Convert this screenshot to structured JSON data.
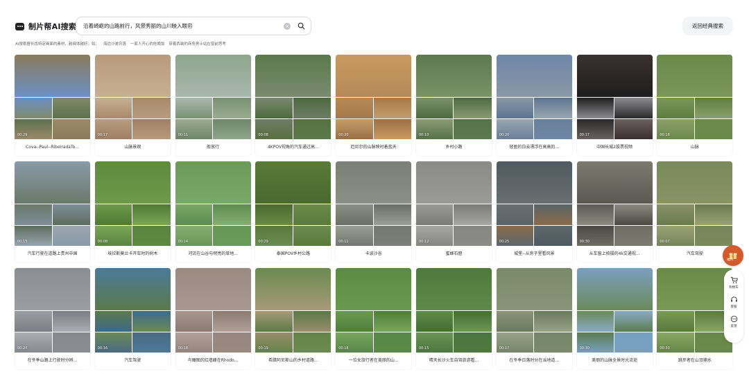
{
  "header": {
    "logo_text": "制片帮AI搜索",
    "search_value": "沿着崎岖的山路前行，风景秀丽的山川映入眼帘",
    "clear_label": "×",
    "return_label": "返回经典搜索",
    "hint_segments": [
      "AI搜索擅长找特定画面的素材，越具体越好。如：",
      "海边沙滩日落",
      "一家人开心的吃晚饭",
      "穿着西装的商务男士站在窗前思考"
    ]
  },
  "cards": [
    {
      "caption": "Cova--Paul--RibeiradaTo...",
      "duration": "00:29",
      "colors": [
        "#8a7b5c",
        "#6b8fc4",
        "#7f8b6a",
        "#5c7050",
        "#9a8a68"
      ]
    },
    {
      "caption": "山脉景观",
      "duration": "00:17",
      "colors": [
        "#b89a7a",
        "#c6b092",
        "#a88a6a",
        "#b79c7e",
        "#9f8064"
      ]
    },
    {
      "caption": "般放行",
      "duration": "00:11",
      "colors": [
        "#8ea58c",
        "#a9b8ae",
        "#7a9172",
        "#9aab90",
        "#6f8668"
      ]
    },
    {
      "caption": "4KPOV视角的汽车通过高...",
      "duration": "00:08",
      "colors": [
        "#5a7a4a",
        "#7a8a70",
        "#4c6a3e",
        "#6e7c66",
        "#58703f"
      ]
    },
    {
      "caption": "厄尼尔的山脉映衬着蓝天",
      "duration": "00:20",
      "colors": [
        "#c89a60",
        "#b58a58",
        "#a67848",
        "#c69c6a",
        "#9c7046"
      ]
    },
    {
      "caption": "乡村小路",
      "duration": "00:10",
      "colors": [
        "#5c7a4e",
        "#7a9266",
        "#4e6a42",
        "#8a9a74",
        "#56724a"
      ]
    },
    {
      "caption": "轻盈的白云漂浮在高高的...",
      "duration": "00:20",
      "colors": [
        "#6e86a8",
        "#8a98a6",
        "#5c7490",
        "#9aa6b0",
        "#6a8098"
      ]
    },
    {
      "caption": "中国长城2股票视频",
      "duration": "00:17",
      "colors": [
        "#3a3030",
        "#1e1e1e",
        "#8c8c90",
        "#2a2a2a",
        "#6a6060"
      ]
    },
    {
      "caption": "山脉",
      "duration": "00:18",
      "colors": [
        "#6a8a4a",
        "#7a9658",
        "#5e7e40",
        "#8aa068",
        "#6c8a4c"
      ]
    },
    {
      "caption": "汽车行驶在道路上贵州中国",
      "duration": "00:15",
      "colors": [
        "#8a9aa8",
        "#6a7a6a",
        "#7e8e98",
        "#5c6c5c",
        "#9aa6b0"
      ]
    },
    {
      "caption": "埃拉斯莫兰卡开车时的树木",
      "duration": "00:08",
      "colors": [
        "#5e8a3e",
        "#6e9a4a",
        "#4e7a34",
        "#7aa656",
        "#5a8440"
      ]
    },
    {
      "caption": "河流在山谷与明亮的草地...",
      "duration": "00:14",
      "colors": [
        "#6a9a5a",
        "#7aa868",
        "#5c8c4e",
        "#86ae72",
        "#689858"
      ]
    },
    {
      "caption": "泰国POV乡村公路",
      "duration": "00:29",
      "colors": [
        "#5a7a3a",
        "#4a6a2e",
        "#6a8a48",
        "#587a3c",
        "#6a8c50"
      ]
    },
    {
      "caption": "卡波沙谷",
      "duration": "00:11",
      "colors": [
        "#7a8078",
        "#8a9088",
        "#6a7068",
        "#989e96",
        "#747a72"
      ]
    },
    {
      "caption": "蜜蜂石窟",
      "duration": "00:12",
      "colors": [
        "#8a8a86",
        "#9a9a96",
        "#7a7a76",
        "#a6a6a2",
        "#868682"
      ]
    },
    {
      "caption": "城堡--从房子里看风景",
      "duration": "00:25",
      "colors": [
        "#4e5a60",
        "#6a6e70",
        "#5a6468",
        "#8a6a4a",
        "#5e686c"
      ]
    },
    {
      "caption": "从车窗上拍摄的4k交通视...",
      "duration": "00:30",
      "colors": [
        "#7a7a70",
        "#5a5a52",
        "#8a8a80",
        "#4a4a44",
        "#6e6e64"
      ]
    },
    {
      "caption": "汽车驾驶",
      "duration": "00:07",
      "colors": [
        "#7a8a5a",
        "#8a9266",
        "#6a7a4e",
        "#9aa274",
        "#76865a"
      ]
    },
    {
      "caption": "在冬季山路上行驶时分辨...",
      "duration": "00:24",
      "colors": [
        "#8a8e92",
        "#9a9ea2",
        "#7a7e82",
        "#aaaeb2",
        "#868a8e"
      ]
    },
    {
      "caption": "汽车驾驶",
      "duration": "00:16",
      "colors": [
        "#4a7a9a",
        "#5a7a4a",
        "#3e6a8a",
        "#6a8a58",
        "#4a6a82"
      ]
    },
    {
      "caption": "鸟瞰图的红墙峰在Rhodo...",
      "duration": "00:18",
      "colors": [
        "#9a8a80",
        "#a89890",
        "#8a7a70",
        "#b0a098",
        "#968680"
      ]
    },
    {
      "caption": "希腊阿尼斯山的乡村道路...",
      "duration": "00:19",
      "colors": [
        "#6a8a50",
        "#a89a78",
        "#5a7a44",
        "#9a8c6c",
        "#648448"
      ]
    },
    {
      "caption": "一位女旅行者在美丽的山...",
      "duration": "00:18",
      "colors": [
        "#5a8a44",
        "#6a9a52",
        "#4e7e3a",
        "#78a65e",
        "#588848"
      ]
    },
    {
      "caption": "晴天长沙火车自驾旅游看...",
      "duration": "00:15",
      "colors": [
        "#4e7a3e",
        "#5e8a4a",
        "#426e34",
        "#6c9656",
        "#4a7640"
      ]
    },
    {
      "caption": "在冬季日落时分在当地道...",
      "duration": "00:17",
      "colors": [
        "#7a8a6a",
        "#8a9478",
        "#6a7a5c",
        "#98a286",
        "#76866a"
      ]
    },
    {
      "caption": "美丽的山脉全景时光流逝",
      "duration": "00:30",
      "colors": [
        "#7aa0c0",
        "#6a8a5a",
        "#8aaac6",
        "#5c7c4e",
        "#76a0c0"
      ]
    },
    {
      "caption": "跳步者在山顶捕水",
      "duration": "00:30",
      "colors": [
        "#6a8a4a",
        "#7a9a58",
        "#5a7a3e",
        "#88a664",
        "#668848"
      ]
    }
  ],
  "sidebar": {
    "gift_label": "福利",
    "items": [
      {
        "label": "购物车",
        "icon": "cart-icon"
      },
      {
        "label": "客服",
        "icon": "headset-icon"
      },
      {
        "label": "反馈",
        "icon": "feedback-icon"
      }
    ]
  }
}
